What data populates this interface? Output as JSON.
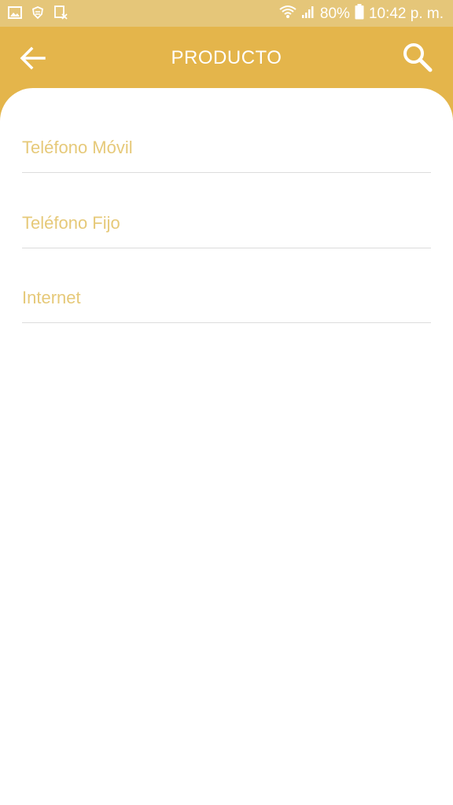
{
  "status_bar": {
    "battery_percent": "80%",
    "time": "10:42 p. m.",
    "icons": [
      "image-icon",
      "shield-icon",
      "file-x-icon",
      "wifi-icon",
      "signal-icon",
      "battery-icon"
    ]
  },
  "header": {
    "title": "PRODUCTO",
    "back_icon": "arrow-left-icon",
    "search_icon": "search-icon"
  },
  "list": {
    "items": [
      {
        "label": "Teléfono Móvil"
      },
      {
        "label": "Teléfono Fijo"
      },
      {
        "label": "Internet"
      }
    ]
  },
  "colors": {
    "accent": "#e4b54b",
    "status_bar": "#e5c679",
    "item_text": "#e6c979",
    "divider": "#dcdcdc"
  }
}
